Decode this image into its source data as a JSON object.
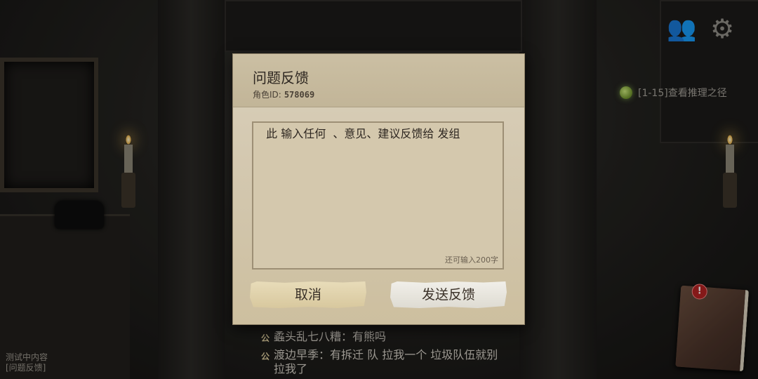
{
  "scene": {
    "hint_text": "[1-15]查看推理之径",
    "bottom_left": [
      "测试中内容",
      "[问题反馈]"
    ],
    "notebook_alert": "!"
  },
  "chat": [
    {
      "badge": "公",
      "text": "蟊头乱七八糟：有熊吗"
    },
    {
      "badge": "公",
      "text": "渡边早季：有拆迁 队 拉我一个 垃圾队伍就别拉我了"
    }
  ],
  "dialog": {
    "title": "问题反馈",
    "role_label": "角色ID:",
    "role_id": "578069",
    "placeholder": "  此 输入任何  、意见、建议反馈给 发组",
    "char_count": "还可输入200字",
    "cancel_label": "取消",
    "send_label": "发送反馈"
  },
  "icons": {
    "friends": "friends-icon",
    "settings": "gear-icon",
    "hint": "hint-orb-icon",
    "notebook": "notebook-icon"
  },
  "colors": {
    "paper": "#d7ccb5",
    "hint_orb": "#a8cc55",
    "alert": "#b22222"
  }
}
